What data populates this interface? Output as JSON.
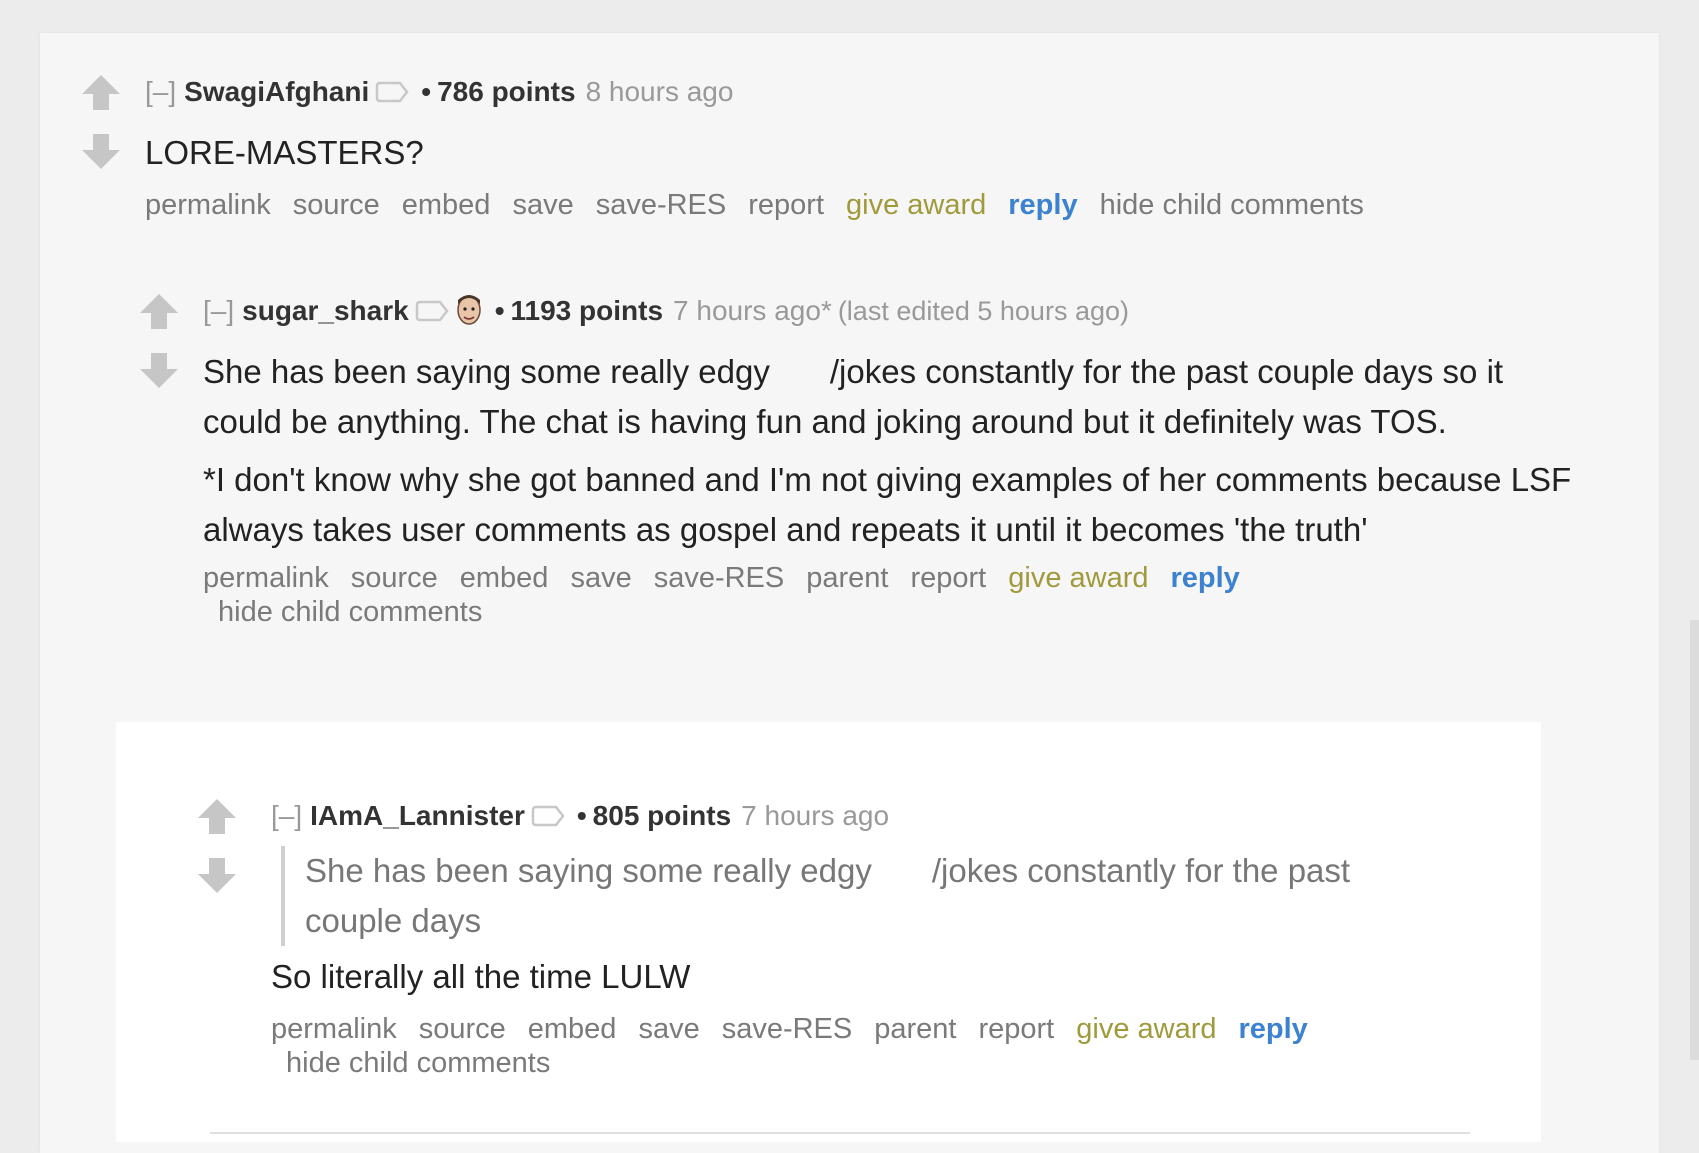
{
  "colors": {
    "background": "#ececec",
    "panel": "#f6f6f6",
    "reply_blue": "#3d82d0",
    "award_gold": "#a09a3c",
    "meta_gray": "#999999"
  },
  "comments": [
    {
      "toggle": "[–]",
      "author": "SwagiAfghani",
      "score": "786 points",
      "time": "8 hours ago",
      "body": [
        "LORE-MASTERS?"
      ],
      "buttons": {
        "permalink": "permalink",
        "source": "source",
        "embed": "embed",
        "save": "save",
        "save_res": "save-RES",
        "report": "report",
        "give_award": "give award",
        "reply": "reply",
        "hide_child": "hide child comments"
      }
    },
    {
      "toggle": "[–]",
      "author": "sugar_shark",
      "score": "1193 points",
      "time": "7 hours ago*",
      "edited": "(last edited 5 hours ago)",
      "body_line1_a": "She has been saying some really edgy",
      "body_line1_b": "/jokes constantly for the past couple days so",
      "body_line2": "it could be anything. The chat is having fun and joking around but it definitely was TOS.",
      "body_p2": "*I don't know why she got banned and I'm not giving examples of her comments because LSF always takes user comments as gospel and repeats it until it becomes 'the truth'",
      "buttons": {
        "permalink": "permalink",
        "source": "source",
        "embed": "embed",
        "save": "save",
        "save_res": "save-RES",
        "parent": "parent",
        "report": "report",
        "give_award": "give award",
        "reply": "reply",
        "hide_child": "hide child comments"
      }
    },
    {
      "toggle": "[–]",
      "author": "IAmA_Lannister",
      "score": "805 points",
      "time": "7 hours ago",
      "quote_a": "She has been saying some really edgy",
      "quote_b": "/jokes constantly for the past",
      "quote_c": "couple days",
      "body": "So literally all the time LULW",
      "buttons": {
        "permalink": "permalink",
        "source": "source",
        "embed": "embed",
        "save": "save",
        "save_res": "save-RES",
        "parent": "parent",
        "report": "report",
        "give_award": "give award",
        "reply": "reply",
        "hide_child": "hide child comments"
      }
    }
  ]
}
